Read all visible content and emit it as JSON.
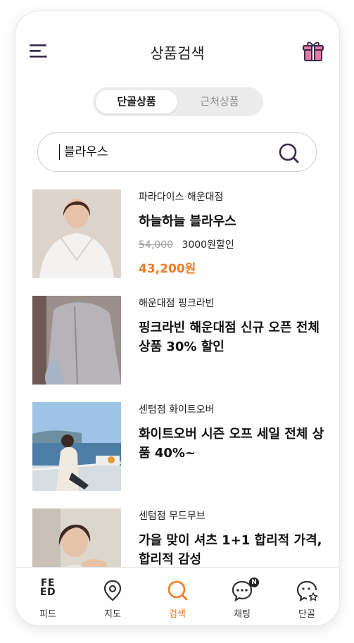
{
  "header": {
    "title": "상품검색"
  },
  "segment": {
    "tabs": [
      {
        "label": "단골상품",
        "active": true
      },
      {
        "label": "근처상품",
        "active": false
      }
    ]
  },
  "search": {
    "value": "블라우스",
    "placeholder": ""
  },
  "items": [
    {
      "store": "파라다이스 해운대점",
      "name": "하늘하늘 블라우스",
      "original_price": "54,000",
      "discount": "3000원할인",
      "final_price": "43,200원"
    },
    {
      "store": "해운대점 핑크라빈",
      "name": "핑크라빈 해운대점 신규 오픈 전체 상품 30% 할인"
    },
    {
      "store": "센텀점 화이트오버",
      "name": "화이트오버 시즌 오프 세일 전체 상품 40%~"
    },
    {
      "store": "센텀점 무드무브",
      "name": "가을 맞이 셔츠 1+1 합리적 가격, 합리적 감성"
    }
  ],
  "nav": {
    "feed_glyph": "FE\nED",
    "items": [
      {
        "label": "피드"
      },
      {
        "label": "지도"
      },
      {
        "label": "검색",
        "active": true
      },
      {
        "label": "채팅",
        "badge": "N"
      },
      {
        "label": "단골"
      }
    ]
  },
  "colors": {
    "accent": "#f07a25",
    "icon": "#3b2a4a",
    "gift": "#e77aa5"
  }
}
